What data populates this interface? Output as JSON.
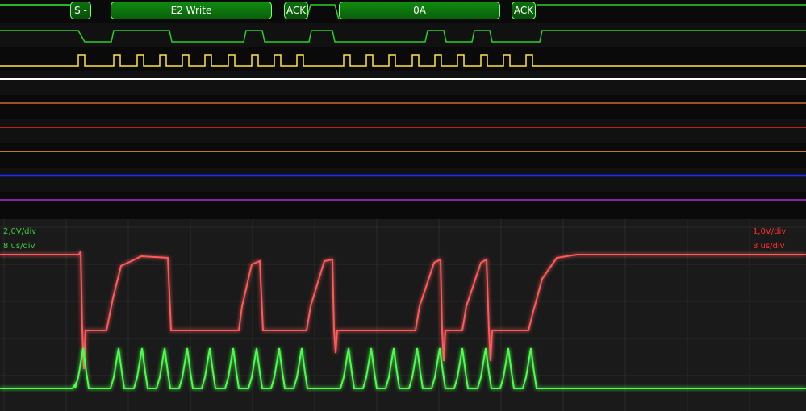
{
  "decoder": {
    "packets": [
      {
        "label": "S -"
      },
      {
        "label": "E2 Write"
      },
      {
        "label": "ACK"
      },
      {
        "label": "0A"
      },
      {
        "label": "ACK"
      }
    ]
  },
  "channels": [
    {
      "name": "i2c-decode-lane",
      "color": "#2bd12b"
    },
    {
      "name": "sda-lane",
      "color": "#2bd12b"
    },
    {
      "name": "scl-lane",
      "color": "#ffe14a"
    },
    {
      "name": "white-lane",
      "color": "#ffffff"
    },
    {
      "name": "orange-lane-1",
      "color": "#c96a2a"
    },
    {
      "name": "red-lane",
      "color": "#ff2020"
    },
    {
      "name": "orange-lane-2",
      "color": "#ff9a30"
    },
    {
      "name": "blue-lane",
      "color": "#1c2cff"
    },
    {
      "name": "purple-lane",
      "color": "#b02ad6"
    }
  ],
  "scope": {
    "left_scale": {
      "volts": "2,0V/div",
      "time": "8 us/div",
      "color": "#3bd13b"
    },
    "right_scale": {
      "volts": "1,0V/div",
      "time": "8 us/div",
      "color": "#ff3030"
    }
  }
}
